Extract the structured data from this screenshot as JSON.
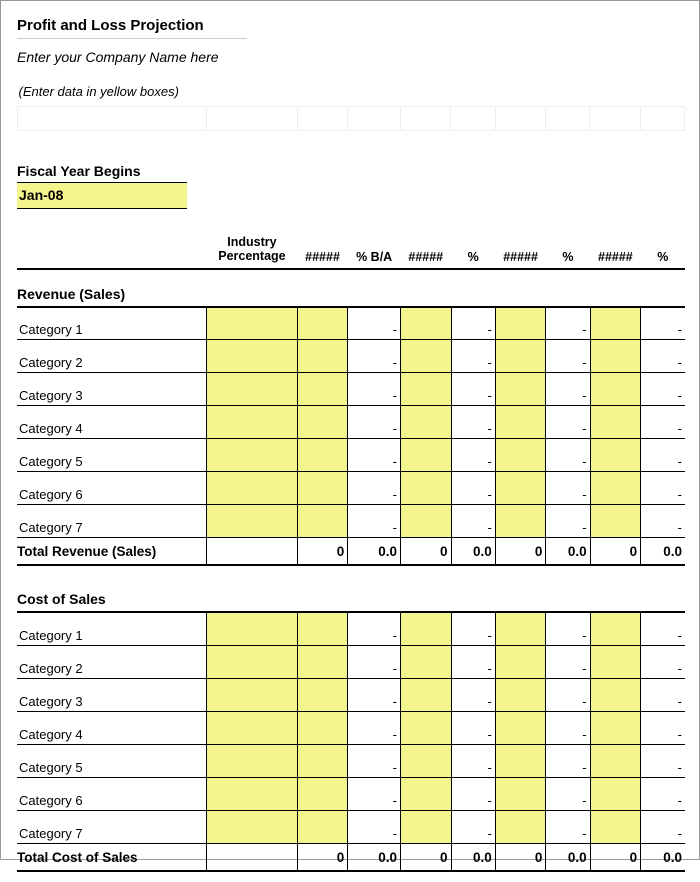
{
  "title": "Profit and Loss Projection",
  "company_placeholder": "Enter your Company Name here",
  "hint": "(Enter data in yellow boxes)",
  "fiscal_year_label": "Fiscal Year Begins",
  "fiscal_year_value": "Jan-08",
  "headers": {
    "industry_percentage": "Industry Percentage",
    "h1": "#####",
    "p1": "% B/A",
    "h2": "#####",
    "p2": "%",
    "h3": "#####",
    "p3": "%",
    "h4": "#####",
    "p4": "%"
  },
  "revenue": {
    "title": "Revenue (Sales)",
    "categories": [
      "Category 1",
      "Category 2",
      "Category 3",
      "Category 4",
      "Category 5",
      "Category 6",
      "Category 7"
    ],
    "row_dash": "-",
    "total_label": "Total Revenue (Sales)",
    "total_int": "0",
    "total_dec": "0.0"
  },
  "cost": {
    "title": "Cost of Sales",
    "categories": [
      "Category 1",
      "Category 2",
      "Category 3",
      "Category 4",
      "Category 5",
      "Category 6",
      "Category 7"
    ],
    "row_dash": "-",
    "total_label": "Total Cost of Sales",
    "total_int": "0",
    "total_dec": "0.0"
  }
}
